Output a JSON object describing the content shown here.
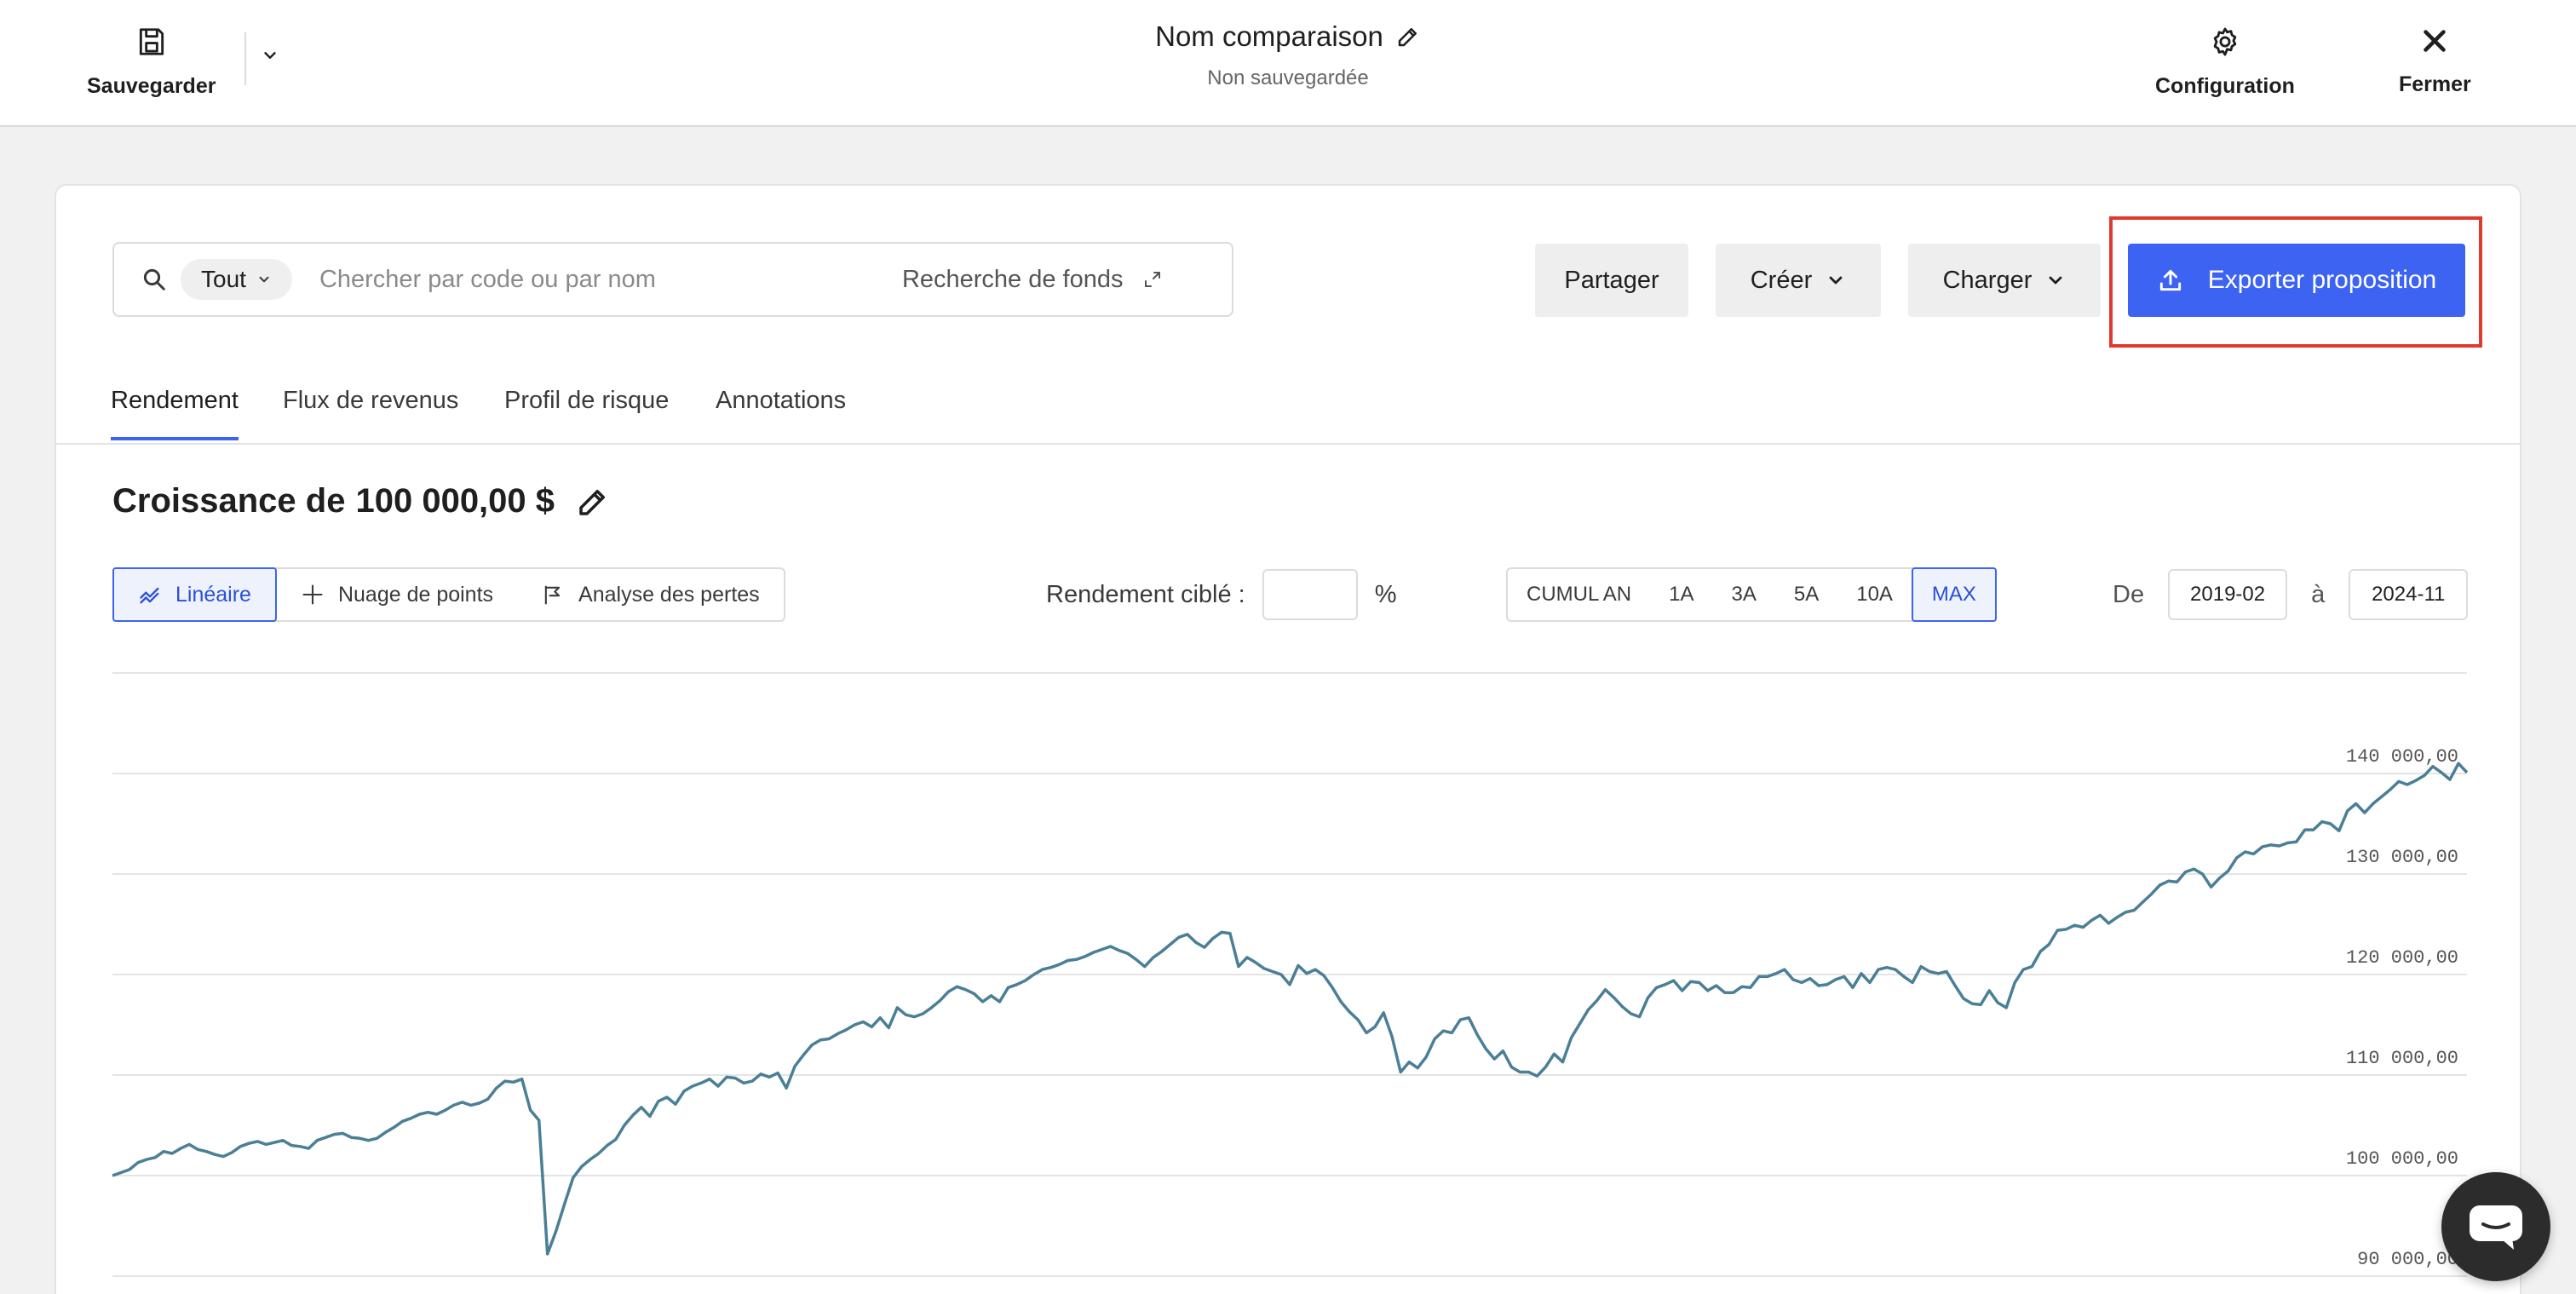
{
  "topbar": {
    "save_label": "Sauvegarder",
    "title": "Nom comparaison",
    "subtitle": "Non sauvegardée",
    "config_label": "Configuration",
    "close_label": "Fermer",
    "icons": [
      "save-icon",
      "chevron-down-icon",
      "pencil-icon",
      "gear-icon",
      "close-icon"
    ]
  },
  "search": {
    "scope": "Tout",
    "placeholder": "Chercher par code ou par nom",
    "value": "",
    "fund_search_label": "Recherche de fonds"
  },
  "actions": {
    "share": "Partager",
    "create": "Créer",
    "load": "Charger",
    "export": "Exporter proposition"
  },
  "colors": {
    "accent": "#3d63f2",
    "highlight": "#e03a2f",
    "line": "#4a7f96"
  },
  "tabs": [
    {
      "label": "Rendement",
      "active": true
    },
    {
      "label": "Flux de revenus",
      "active": false
    },
    {
      "label": "Profil de risque",
      "active": false
    },
    {
      "label": "Annotations",
      "active": false
    }
  ],
  "growth": {
    "prefix": "Croissance de",
    "amount": "100 000,00 $"
  },
  "views": [
    {
      "label": "Linéaire",
      "icon": "line-chart-icon",
      "active": true
    },
    {
      "label": "Nuage de points",
      "icon": "scatter-icon",
      "active": false
    },
    {
      "label": "Analyse des pertes",
      "icon": "drawdown-icon",
      "active": false
    }
  ],
  "target": {
    "label": "Rendement ciblé :",
    "value": "",
    "unit": "%"
  },
  "periods": [
    {
      "label": "CUMUL AN",
      "active": false
    },
    {
      "label": "1A",
      "active": false
    },
    {
      "label": "3A",
      "active": false
    },
    {
      "label": "5A",
      "active": false
    },
    {
      "label": "10A",
      "active": false
    },
    {
      "label": "MAX",
      "active": true
    }
  ],
  "range": {
    "from_label": "De",
    "from": "2019-02",
    "to_label": "à",
    "to": "2024-11"
  },
  "chart_data": {
    "type": "line",
    "title": "",
    "xlabel": "",
    "ylabel": "",
    "x_range": [
      "2019-02",
      "2024-11"
    ],
    "ylim": [
      90000,
      150000
    ],
    "grid": true,
    "y_ticks": [
      "140 000,00",
      "130 000,00",
      "120 000,00",
      "110 000,00",
      "100 000,00",
      "90 000,00"
    ],
    "y_tick_values": [
      140000,
      130000,
      120000,
      110000,
      100000,
      90000
    ],
    "series": [
      {
        "values": [
          100000,
          100300,
          100600,
          101300,
          101600,
          101800,
          102400,
          102200,
          102700,
          103100,
          102600,
          102400,
          102100,
          101900,
          102300,
          102900,
          103200,
          103400,
          103100,
          103300,
          103500,
          103000,
          102900,
          102700,
          103500,
          103800,
          104100,
          104200,
          103800,
          103700,
          103500,
          103700,
          104300,
          104800,
          105400,
          105700,
          106100,
          106300,
          106100,
          106500,
          107000,
          107300,
          107000,
          107200,
          107600,
          108700,
          109400,
          109300,
          109600,
          106500,
          105500,
          92200,
          94500,
          97200,
          99800,
          100900,
          101600,
          102200,
          103000,
          103600,
          105000,
          106000,
          106800,
          105900,
          107400,
          107800,
          107100,
          108400,
          108900,
          109200,
          109600,
          108900,
          109800,
          109700,
          109200,
          109400,
          110100,
          109800,
          110200,
          108700,
          110900,
          112000,
          113000,
          113500,
          113600,
          114100,
          114500,
          115000,
          115300,
          114800,
          115700,
          114700,
          116700,
          116000,
          115800,
          116100,
          116700,
          117400,
          118300,
          118800,
          118500,
          118100,
          117300,
          117900,
          117300,
          118700,
          119000,
          119400,
          120000,
          120500,
          120700,
          121000,
          121400,
          121500,
          121800,
          122200,
          122500,
          122800,
          122400,
          122100,
          121500,
          120800,
          121700,
          122300,
          123000,
          123700,
          124000,
          123200,
          122700,
          123600,
          124200,
          124100,
          120800,
          121700,
          121200,
          120600,
          120300,
          120000,
          119000,
          120900,
          120100,
          120500,
          119900,
          118700,
          117300,
          116300,
          115500,
          114200,
          114800,
          116200,
          113800,
          110300,
          111300,
          110700,
          111800,
          113600,
          114400,
          114200,
          115500,
          115700,
          114000,
          112600,
          111600,
          112400,
          110800,
          110300,
          110300,
          109900,
          110800,
          112100,
          111300,
          113700,
          115100,
          116500,
          117400,
          118500,
          117700,
          116800,
          116100,
          115800,
          117700,
          118700,
          119000,
          119400,
          118400,
          119300,
          119200,
          118400,
          118900,
          118200,
          118200,
          118800,
          118700,
          119800,
          119800,
          120100,
          120500,
          119500,
          119200,
          119600,
          118900,
          119000,
          119500,
          119800,
          118700,
          120100,
          119200,
          120500,
          120700,
          120500,
          119800,
          119200,
          120800,
          120300,
          120100,
          120300,
          118900,
          117600,
          117100,
          117000,
          118400,
          117200,
          116700,
          119200,
          120500,
          120800,
          122300,
          123000,
          124400,
          124500,
          124900,
          124700,
          125400,
          125900,
          125100,
          125700,
          126200,
          126400,
          127200,
          128000,
          128900,
          129300,
          129200,
          130200,
          130500,
          130000,
          128700,
          129600,
          130300,
          131600,
          132200,
          132000,
          132700,
          132900,
          132800,
          133100,
          133200,
          134400,
          134400,
          135200,
          135000,
          134300,
          136300,
          137000,
          136100,
          137000,
          137700,
          138400,
          139200,
          138900,
          139300,
          139800,
          140700,
          140100,
          139400,
          141000,
          140100
        ]
      }
    ]
  }
}
